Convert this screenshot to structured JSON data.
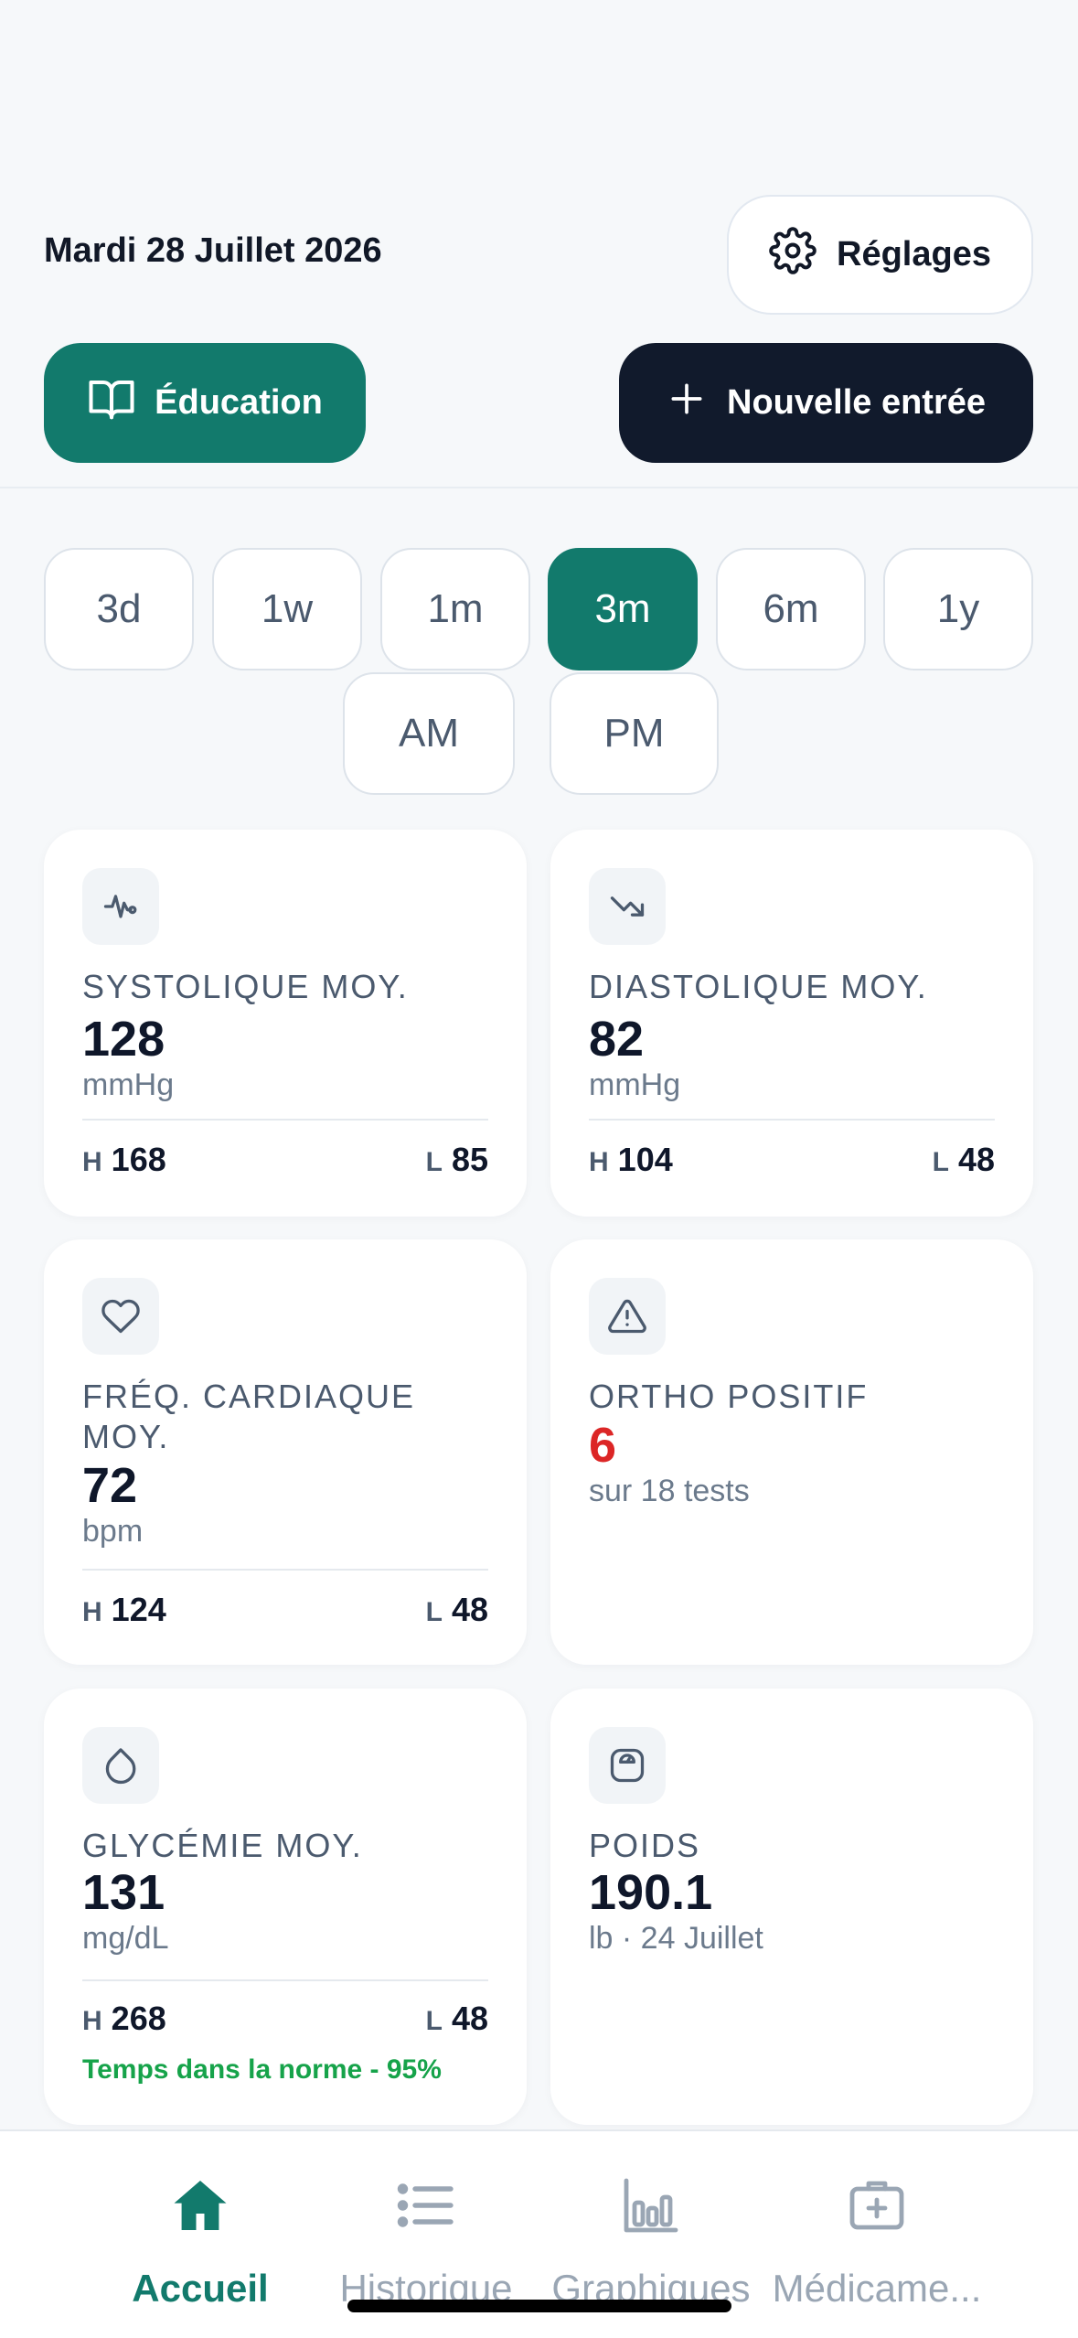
{
  "header": {
    "date": "Mardi 28 Juillet 2026",
    "settings_label": "Réglages",
    "education_label": "Éducation",
    "new_entry_label": "Nouvelle entrée"
  },
  "ranges": {
    "selected": "3m",
    "items": [
      "3d",
      "1w",
      "1m",
      "3m",
      "6m",
      "1y"
    ],
    "periods": [
      "AM",
      "PM"
    ]
  },
  "cards": {
    "systolic": {
      "label": "SYSTOLIQUE MOY.",
      "value": "128",
      "unit": "mmHg",
      "h_key": "H",
      "h": "168",
      "l_key": "L",
      "l": "85"
    },
    "diastolic": {
      "label": "DIASTOLIQUE MOY.",
      "value": "82",
      "unit": "mmHg",
      "h_key": "H",
      "h": "104",
      "l_key": "L",
      "l": "48"
    },
    "heart": {
      "label": "FRÉQ. CARDIAQUE MOY.",
      "value": "72",
      "unit": "bpm",
      "h_key": "H",
      "h": "124",
      "l_key": "L",
      "l": "48"
    },
    "ortho": {
      "label": "ORTHO POSITIF",
      "value": "6",
      "unit": "sur 18 tests"
    },
    "glucose": {
      "label": "GLYCÉMIE MOY.",
      "value": "131",
      "unit": "mg/dL",
      "h_key": "H",
      "h": "268",
      "l_key": "L",
      "l": "48",
      "tir": "Temps dans la norme - 95%"
    },
    "weight": {
      "label": "POIDS",
      "value": "190.1",
      "unit": "lb · 24 Juillet"
    }
  },
  "tabbar": {
    "home": "Accueil",
    "history": "Historique",
    "charts": "Graphiques",
    "meds": "Médicame..."
  },
  "colors": {
    "accent": "#127a6c",
    "dark": "#111a2c",
    "alert": "#dc2626",
    "success": "#16a34a"
  }
}
